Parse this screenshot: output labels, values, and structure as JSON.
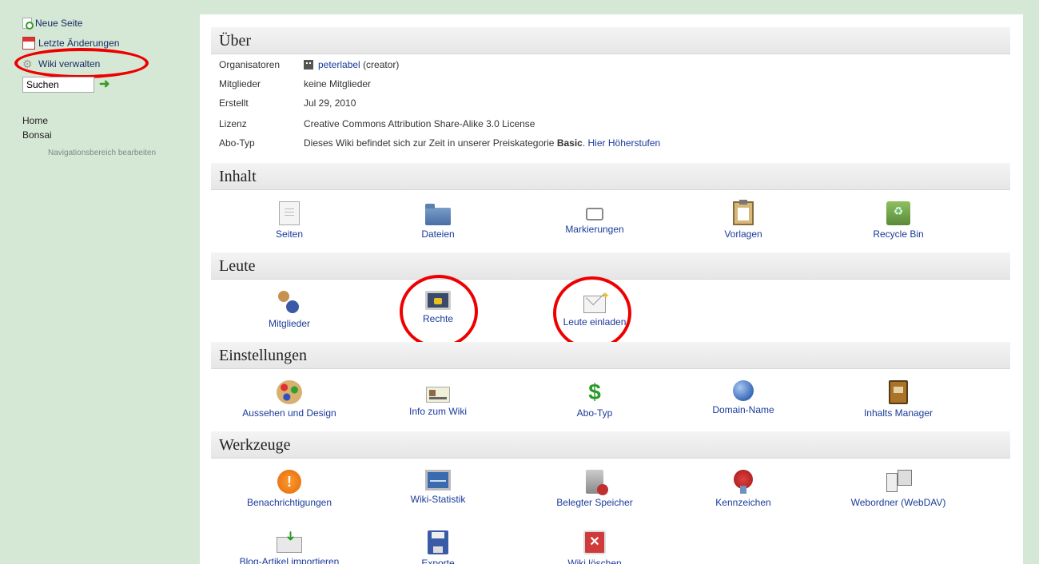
{
  "sidebar": {
    "new_page": "Neue Seite",
    "recent_changes": "Letzte Änderungen",
    "manage_wiki": "Wiki verwalten",
    "search_value": "Suchen",
    "nav": [
      "Home",
      "Bonsai"
    ],
    "edit_nav": "Navigationsbereich bearbeiten"
  },
  "about": {
    "title": "Über",
    "rows": [
      {
        "label": "Organisatoren",
        "value": "peterlabel",
        "suffix": "(creator)"
      },
      {
        "label": "Mitglieder",
        "value": "keine Mitglieder"
      },
      {
        "label": "Erstellt",
        "value": "Jul 29, 2010"
      },
      {
        "label": "Lizenz",
        "value": "Creative Commons Attribution Share-Alike 3.0 License"
      },
      {
        "label": "Abo-Typ",
        "value": "Dieses Wiki befindet sich zur Zeit in unserer Preiskategorie",
        "bold": "Basic",
        "link": "Hier Höherstufen"
      }
    ]
  },
  "sections": {
    "content": {
      "title": "Inhalt",
      "items": [
        "Seiten",
        "Dateien",
        "Markierungen",
        "Vorlagen",
        "Recycle Bin"
      ]
    },
    "people": {
      "title": "Leute",
      "items": [
        "Mitglieder",
        "Rechte",
        "Leute einladen"
      ]
    },
    "settings": {
      "title": "Einstellungen",
      "items": [
        "Aussehen und Design",
        "Info zum Wiki",
        "Abo-Typ",
        "Domain-Name",
        "Inhalts Manager"
      ]
    },
    "tools": {
      "title": "Werkzeuge",
      "items": [
        "Benachrichtigungen",
        "Wiki-Statistik",
        "Belegter Speicher",
        "Kennzeichen",
        "Webordner (WebDAV)",
        "Blog-Artikel importieren",
        "Exporte",
        "Wiki löschen"
      ]
    }
  },
  "icons": {
    "seiten": "page-icon",
    "dateien": "folder-icon",
    "markierungen": "tags-icon",
    "vorlagen": "clipboard-icon",
    "recycle": "recycle-bin-icon",
    "mitglieder": "members-icon",
    "rechte": "lock-monitor-icon",
    "einladen": "invite-mail-icon",
    "aussehen": "palette-icon",
    "info": "id-card-icon",
    "abo": "dollar-icon",
    "domain": "globe-icon",
    "manager": "book-icon",
    "benachrichtigungen": "warning-icon",
    "statistik": "stats-monitor-icon",
    "speicher": "disk-usage-icon",
    "kennzeichen": "badge-seal-icon",
    "webdav": "server-icon",
    "import": "import-icon",
    "export": "save-icon",
    "delete": "delete-icon"
  },
  "colors": {
    "link": "#1a3a9a",
    "background": "#d5e8d5",
    "highlight": "#ee0000"
  }
}
